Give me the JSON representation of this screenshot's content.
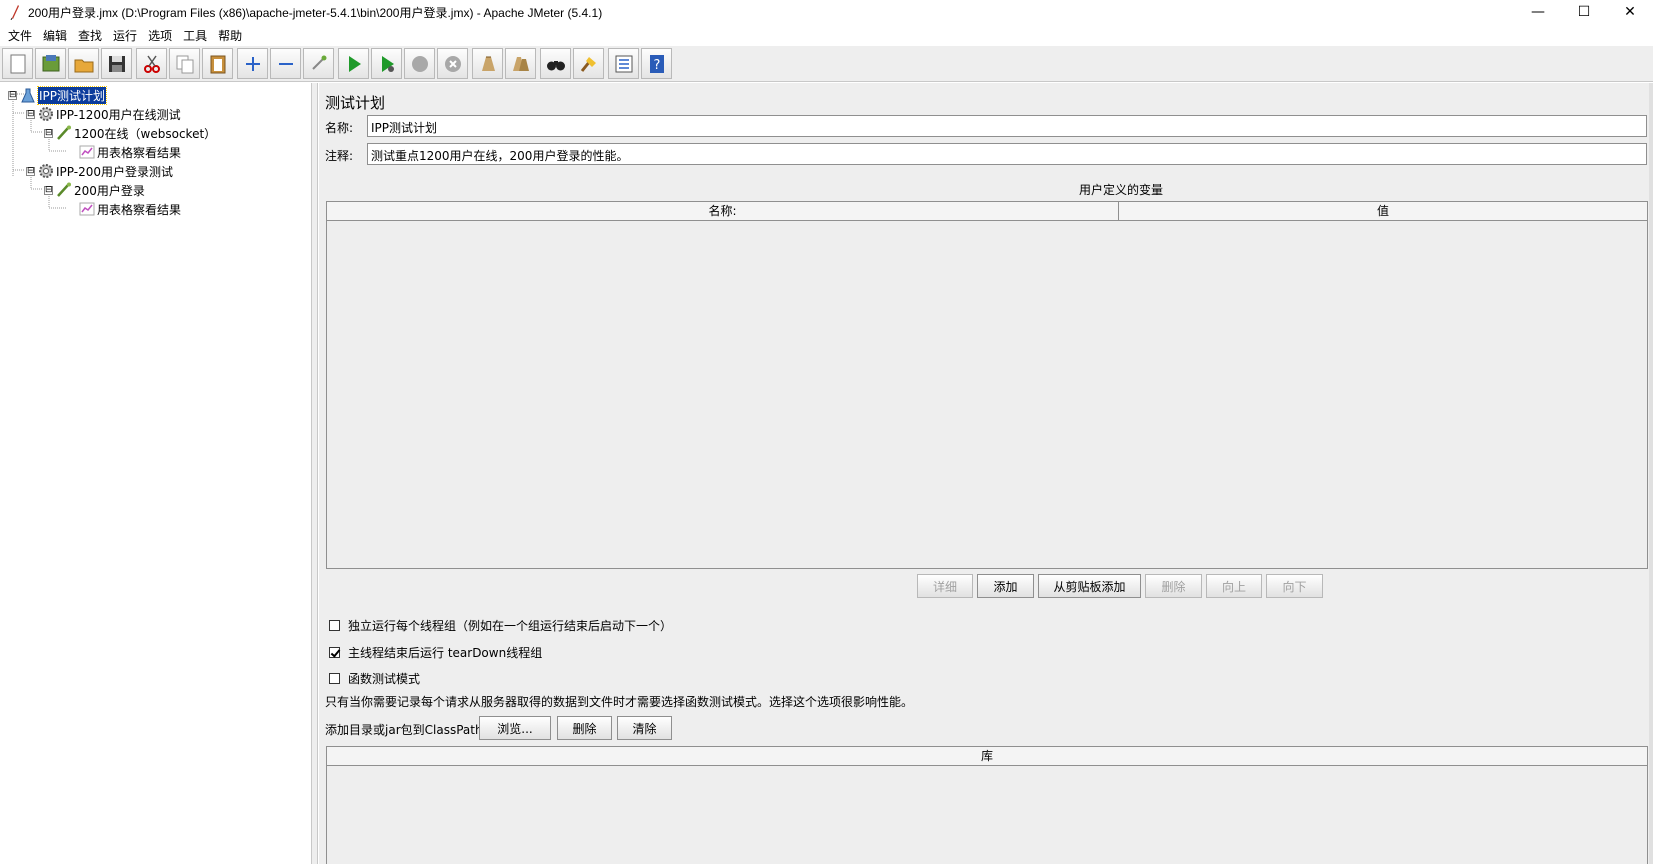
{
  "window": {
    "title": "200用户登录.jmx (D:\\Program Files (x86)\\apache-jmeter-5.4.1\\bin\\200用户登录.jmx) - Apache JMeter (5.4.1)",
    "minimize": "—",
    "maximize": "☐",
    "close": "✕"
  },
  "menu": [
    "文件",
    "编辑",
    "查找",
    "运行",
    "选项",
    "工具",
    "帮助"
  ],
  "toolbar": {
    "icons": [
      "new-file-icon",
      "templates-icon",
      "open-icon",
      "save-icon",
      "cut-icon",
      "copy-icon",
      "paste-icon",
      "expand-icon",
      "collapse-icon",
      "toggle-icon",
      "start-icon",
      "start-no-pause-icon",
      "stop-icon",
      "shutdown-icon",
      "clear-icon",
      "clear-all-icon",
      "search-icon",
      "reset-search-icon",
      "function-helper-icon",
      "help-icon"
    ]
  },
  "tree": {
    "nodes": [
      {
        "label": "IPP测试计划",
        "icon": "test-plan-icon",
        "level": 0,
        "toggle": "⊟",
        "selected": true
      },
      {
        "label": "IPP-1200用户在线测试",
        "icon": "thread-group-gear-icon",
        "level": 1,
        "toggle": "⊟"
      },
      {
        "label": "1200在线（websocket）",
        "icon": "sampler-pen-icon",
        "level": 2,
        "toggle": "⊟"
      },
      {
        "label": "用表格察看结果",
        "icon": "listener-chart-icon",
        "level": 3
      },
      {
        "label": "IPP-200用户登录测试",
        "icon": "thread-group-gear-icon",
        "level": 1,
        "toggle": "⊟"
      },
      {
        "label": "200用户登录",
        "icon": "sampler-pen-icon",
        "level": 2,
        "toggle": "⊟"
      },
      {
        "label": "用表格察看结果",
        "icon": "listener-chart-icon",
        "level": 3
      }
    ]
  },
  "panel": {
    "title": "测试计划",
    "name_label": "名称:",
    "name_value": "IPP测试计划",
    "comment_label": "注释:",
    "comment_value": "测试重点1200用户在线，200用户登录的性能。",
    "vars_title": "用户定义的变量",
    "vars_columns": [
      "名称:",
      "值"
    ],
    "buttons": [
      {
        "label": "详细",
        "enabled": false
      },
      {
        "label": "添加",
        "enabled": true
      },
      {
        "label": "从剪贴板添加",
        "enabled": true
      },
      {
        "label": "删除",
        "enabled": false
      },
      {
        "label": "向上",
        "enabled": false
      },
      {
        "label": "向下",
        "enabled": false
      }
    ],
    "checks": [
      {
        "label": "独立运行每个线程组（例如在一个组运行结束后启动下一个）",
        "checked": false
      },
      {
        "label": "主线程结束后运行 tearDown线程组",
        "checked": true
      },
      {
        "label": "函数测试模式",
        "checked": false
      }
    ],
    "functional_note": "只有当你需要记录每个请求从服务器取得的数据到文件时才需要选择函数测试模式。选择这个选项很影响性能。",
    "classpath_label": "添加目录或jar包到ClassPath",
    "classpath_buttons": [
      "浏览...",
      "删除",
      "清除"
    ],
    "lib_column": "库"
  }
}
